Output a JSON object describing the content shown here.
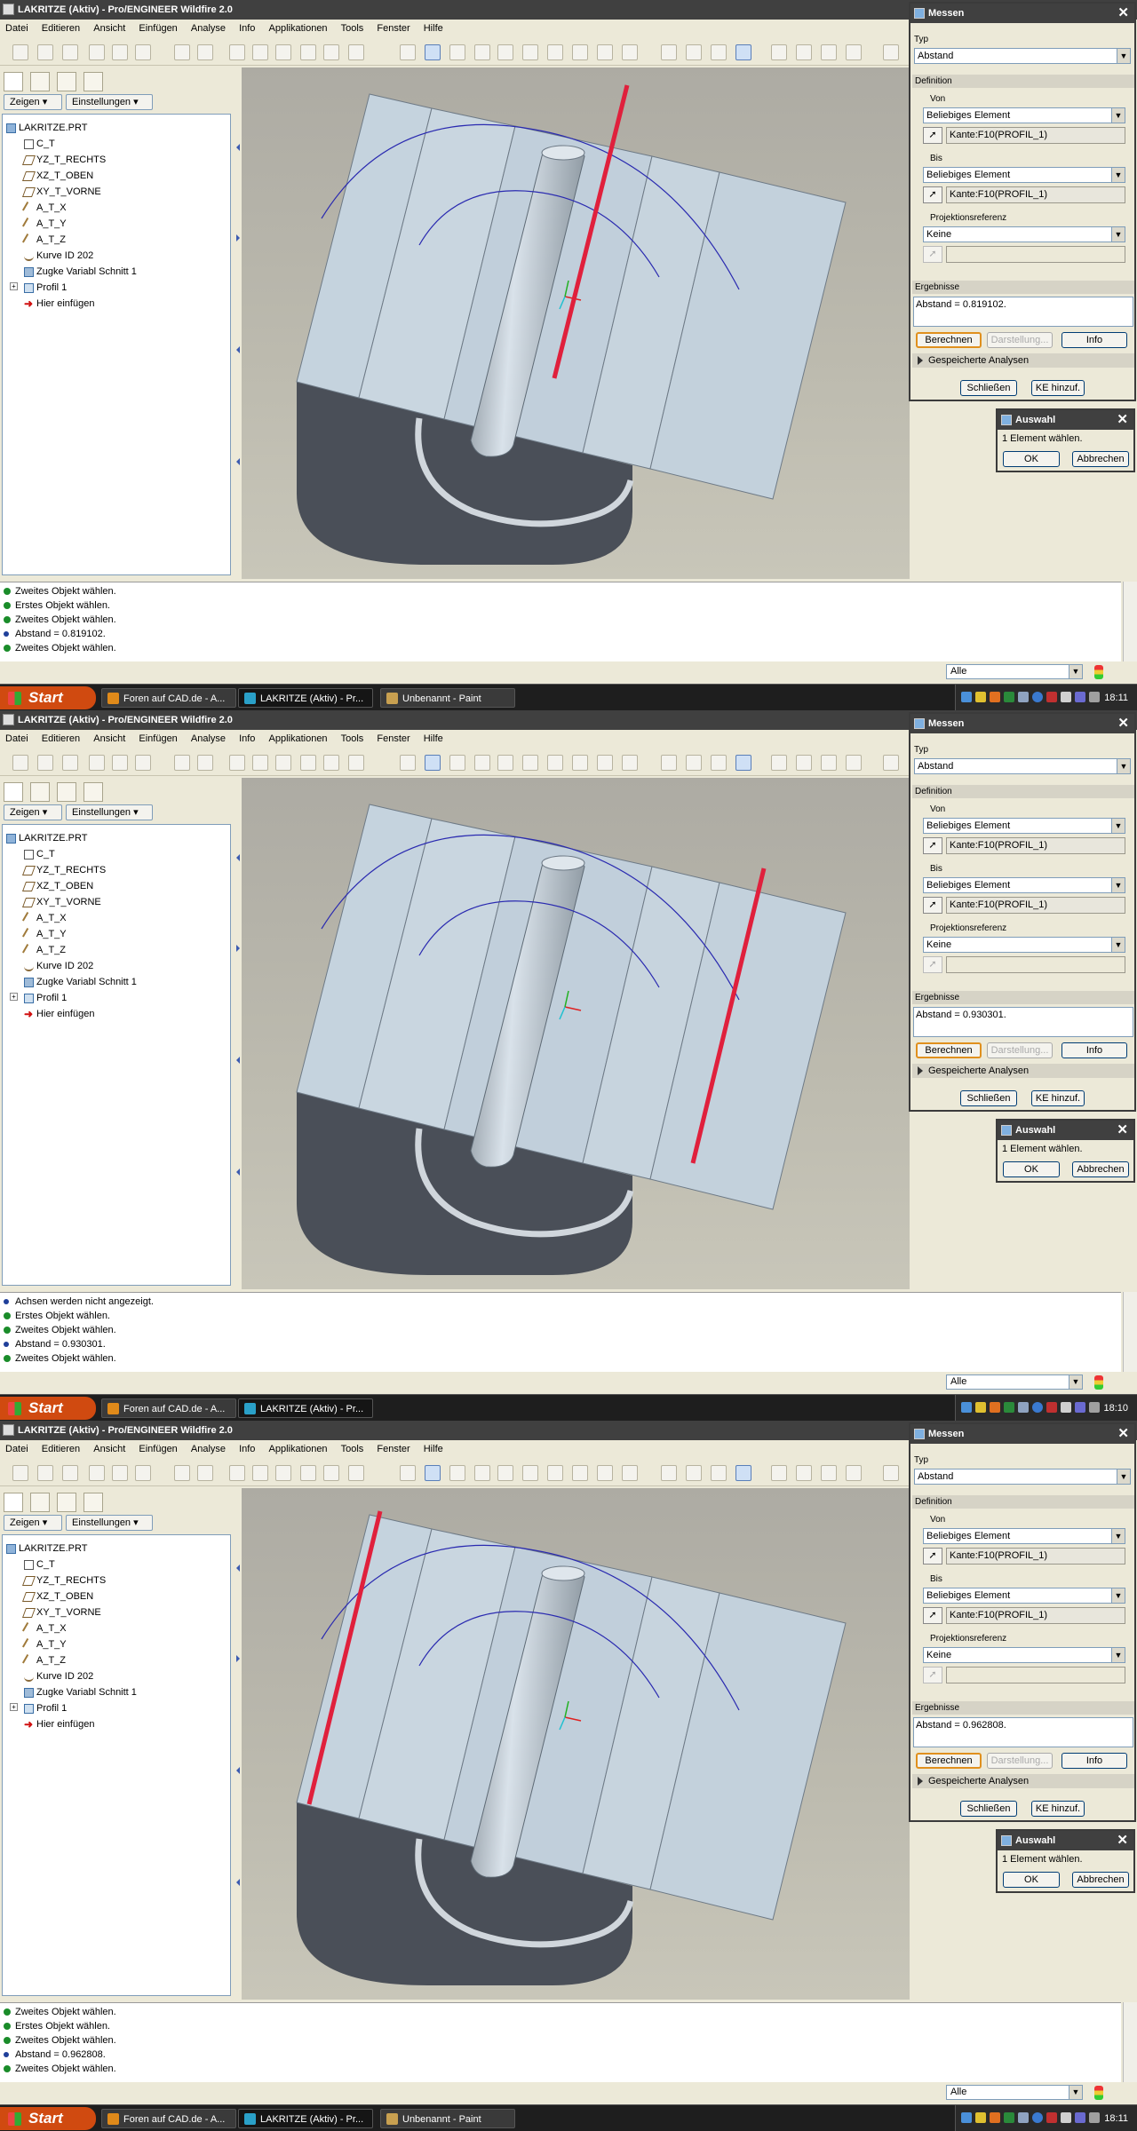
{
  "window_title": "LAKRITZE (Aktiv) - Pro/ENGINEER Wildfire 2.0",
  "menu": [
    "Datei",
    "Editieren",
    "Ansicht",
    "Einfügen",
    "Analyse",
    "Info",
    "Applikationen",
    "Tools",
    "Fenster",
    "Hilfe"
  ],
  "tree_buttons": {
    "show": "Zeigen",
    "settings": "Einstellungen"
  },
  "tree_items": [
    "LAKRITZE.PRT",
    "C_T",
    "YZ_T_RECHTS",
    "XZ_T_OBEN",
    "XY_T_VORNE",
    "A_T_X",
    "A_T_Y",
    "A_T_Z",
    "Kurve ID 202",
    "Zugke Variabl Schnitt 1",
    "Profil 1",
    "Hier einfügen"
  ],
  "measure_dialog": {
    "title": "Messen",
    "type_label": "Typ",
    "type_value": "Abstand",
    "definition_label": "Definition",
    "from_label": "Von",
    "to_label": "Bis",
    "element_choice": "Beliebiges Element",
    "projection_label": "Projektionsreferenz",
    "projection_value": "Keine",
    "results_label": "Ergebnisse",
    "compute_button": "Berechnen",
    "display_button": "Darstellung...",
    "info_button": "Info",
    "saved_analyses": "Gespeicherte Analysen",
    "close_button": "Schließen",
    "add_feature_button": "KE hinzuf."
  },
  "selection_dialog": {
    "title": "Auswahl",
    "message": "1 Element wählen.",
    "ok": "OK",
    "cancel": "Abbrechen"
  },
  "filter_value": "Alle",
  "taskbar": {
    "start": "Start"
  },
  "screens": [
    {
      "from_value": "Kante:F10(PROFIL_1)",
      "to_value": "Kante:F10(PROFIL_1)",
      "result": "Abstand = 0.819102.",
      "messages": [
        {
          "kind": "arrow",
          "text": "Zweites Objekt wählen."
        },
        {
          "kind": "arrow",
          "text": "Erstes Objekt wählen."
        },
        {
          "kind": "arrow",
          "text": "Zweites Objekt wählen."
        },
        {
          "kind": "dot",
          "text": "Abstand = 0.819102."
        },
        {
          "kind": "arrow",
          "text": "Zweites Objekt wählen."
        }
      ],
      "tasks": [
        "Foren auf CAD.de - A...",
        "LAKRITZE (Aktiv) - Pr...",
        "Unbenannt - Paint"
      ],
      "clock": "18:11"
    },
    {
      "from_value": "Kante:F10(PROFIL_1)",
      "to_value": "Kante:F10(PROFIL_1)",
      "result": "Abstand = 0.930301.",
      "messages": [
        {
          "kind": "dot",
          "text": "Achsen werden nicht angezeigt."
        },
        {
          "kind": "arrow",
          "text": "Erstes Objekt wählen."
        },
        {
          "kind": "arrow",
          "text": "Zweites Objekt wählen."
        },
        {
          "kind": "dot",
          "text": "Abstand = 0.930301."
        },
        {
          "kind": "arrow",
          "text": "Zweites Objekt wählen."
        }
      ],
      "tasks": [
        "Foren auf CAD.de - A...",
        "LAKRITZE (Aktiv) - Pr..."
      ],
      "clock": "18:10"
    },
    {
      "from_value": "Kante:F10(PROFIL_1)",
      "to_value": "Kante:F10(PROFIL_1)",
      "result": "Abstand = 0.962808.",
      "messages": [
        {
          "kind": "arrow",
          "text": "Zweites Objekt wählen."
        },
        {
          "kind": "arrow",
          "text": "Erstes Objekt wählen."
        },
        {
          "kind": "arrow",
          "text": "Zweites Objekt wählen."
        },
        {
          "kind": "dot",
          "text": "Abstand = 0.962808."
        },
        {
          "kind": "arrow",
          "text": "Zweites Objekt wählen."
        }
      ],
      "tasks": [
        "Foren auf CAD.de - A...",
        "LAKRITZE (Aktiv) - Pr...",
        "Unbenannt - Paint"
      ],
      "clock": "18:11"
    }
  ],
  "colors": {
    "highlight_edge": "#e0203c",
    "part_face": "#c5d3de",
    "part_side": "#4a4f58",
    "sketch_curve": "#2a2ab0",
    "titlebar": "#404040"
  }
}
